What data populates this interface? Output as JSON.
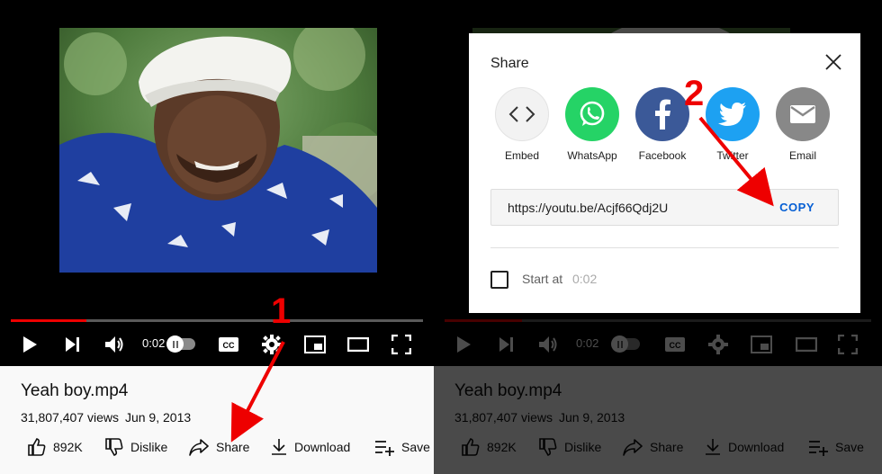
{
  "video": {
    "title": "Yeah boy.mp4",
    "views": "31,807,407 views",
    "date": "Jun 9, 2013",
    "current_time": "0:02",
    "progress": 0.18
  },
  "actions": {
    "like_count": "892K",
    "dislike_label": "Dislike",
    "share_label": "Share",
    "download_label": "Download",
    "save_label": "Save"
  },
  "share_dialog": {
    "title": "Share",
    "targets": [
      {
        "label": "Embed",
        "color": "#f2f2f2",
        "icon": "embed-icon"
      },
      {
        "label": "WhatsApp",
        "color": "#25d366",
        "icon": "whatsapp-icon"
      },
      {
        "label": "Facebook",
        "color": "#3b5998",
        "icon": "facebook-icon"
      },
      {
        "label": "Twitter",
        "color": "#1da1f2",
        "icon": "twitter-icon"
      },
      {
        "label": "Email",
        "color": "#888888",
        "icon": "email-icon"
      }
    ],
    "url": "https://youtu.be/Acjf66Qdj2U",
    "copy_label": "COPY",
    "start_at_label": "Start at",
    "start_at_time": "0:02"
  },
  "annotations": {
    "step1": "1",
    "step2": "2",
    "color": "#e00000"
  }
}
